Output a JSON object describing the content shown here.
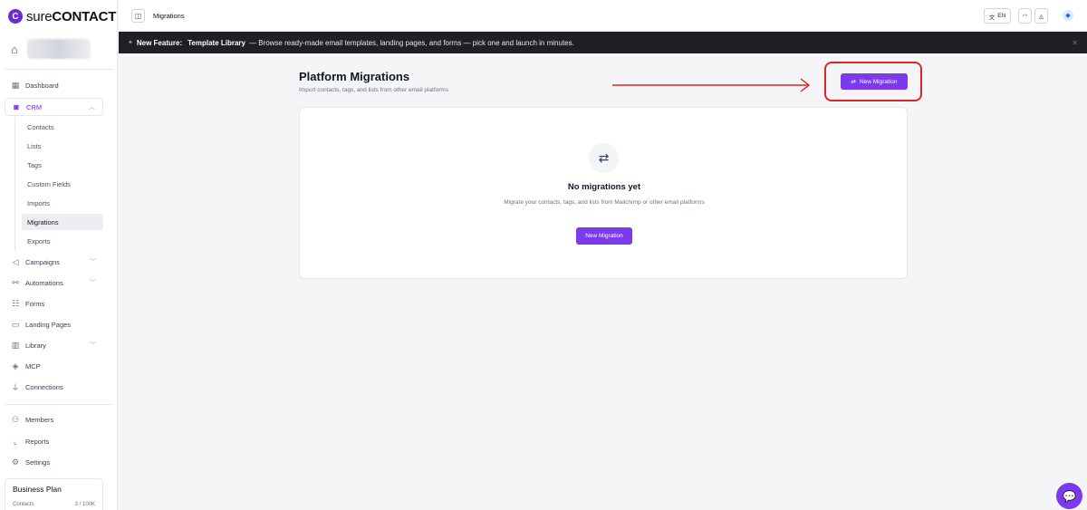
{
  "brand": {
    "sure": "sure",
    "contact": "CONTACT"
  },
  "nav": {
    "dashboard": "Dashboard",
    "crm": "CRM",
    "crm_sub": [
      "Contacts",
      "Lists",
      "Tags",
      "Custom Fields",
      "Imports",
      "Migrations",
      "Exports"
    ],
    "campaigns": "Campaigns",
    "automations": "Automations",
    "forms": "Forms",
    "landing_pages": "Landing Pages",
    "library": "Library",
    "mcp": "MCP",
    "connections": "Connections",
    "members": "Members",
    "reports": "Reports",
    "settings": "Settings"
  },
  "plan": {
    "title": "Business Plan",
    "label": "Contacts",
    "value": "3 / 100K"
  },
  "topbar": {
    "title": "Migrations",
    "lang": "EN"
  },
  "banner": {
    "label": "New Feature:",
    "feature": "Template Library",
    "text": "— Browse ready-made email templates, landing pages, and forms — pick one and launch in minutes."
  },
  "page": {
    "title": "Platform Migrations",
    "subtitle": "Import contacts, tags, and lists from other email platforms",
    "new_button": "New Migration"
  },
  "empty": {
    "title": "No migrations yet",
    "description": "Migrate your contacts, tags, and lists from Mailchimp or other email platforms",
    "button": "New Migration"
  },
  "colors": {
    "accent": "#7c3aed",
    "highlight": "#dc2626"
  }
}
